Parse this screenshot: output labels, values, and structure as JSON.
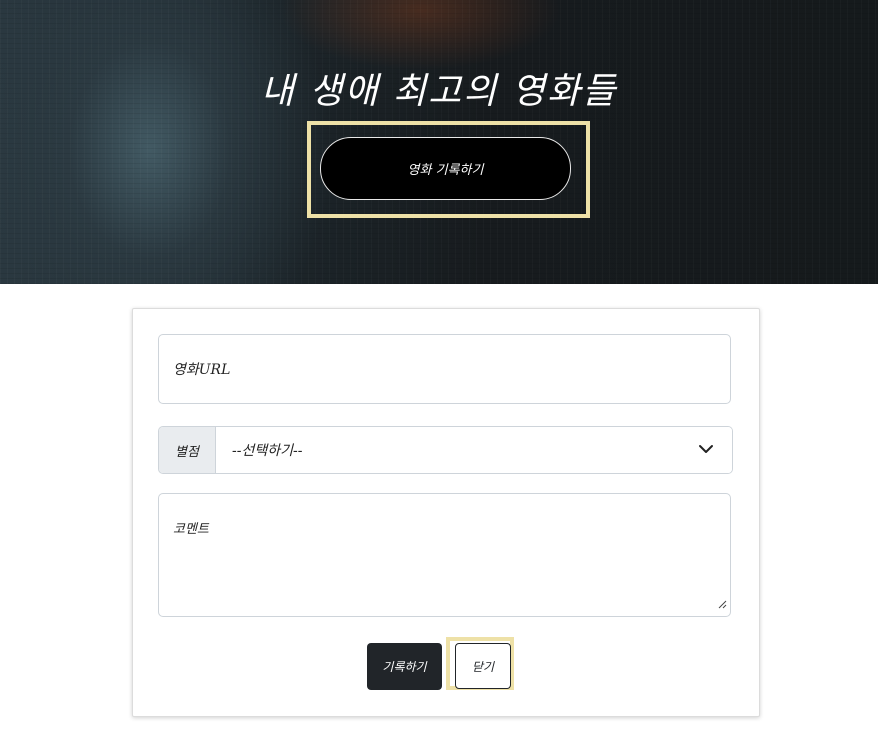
{
  "hero": {
    "title": "내 생애 최고의 영화들",
    "record_button_label": "영화 기록하기"
  },
  "form": {
    "url_placeholder": "영화URL",
    "star_label": "별점",
    "star_selected": "--선택하기--",
    "comment_placeholder": "코멘트",
    "save_label": "기록하기",
    "close_label": "닫기"
  },
  "colors": {
    "highlight": "#eee1a7",
    "dark_button": "#212529"
  },
  "icons": {
    "select_arrow": "chevron-down-icon",
    "textarea_resize": "resize-grip-icon"
  }
}
